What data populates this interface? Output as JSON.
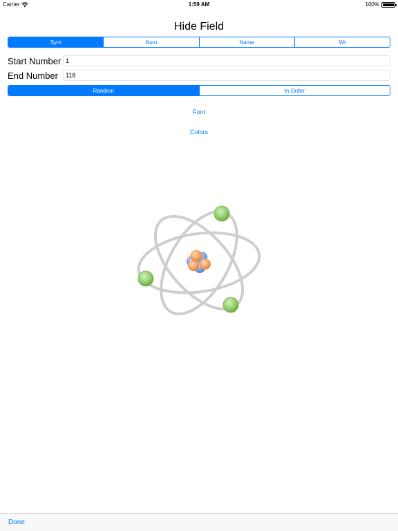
{
  "status_bar": {
    "carrier": "Carrier",
    "time": "1:59 AM",
    "battery": "100%"
  },
  "title": "Hide Field",
  "field_segments": [
    {
      "label": "Sym",
      "selected": true
    },
    {
      "label": "Num",
      "selected": false
    },
    {
      "label": "Name",
      "selected": false
    },
    {
      "label": "Wt",
      "selected": false
    }
  ],
  "start_number": {
    "label": "Start Number",
    "value": "1"
  },
  "end_number": {
    "label": "End Number",
    "value": "118"
  },
  "order_segments": [
    {
      "label": "Random",
      "selected": true
    },
    {
      "label": "In Order",
      "selected": false
    }
  ],
  "buttons": {
    "font": "Font",
    "colors": "Colors"
  },
  "toolbar": {
    "done": "Done"
  },
  "colors": {
    "accent": "#007aff",
    "electron": "#8fcf6a",
    "proton": "#f5a46a",
    "neutron": "#7f9fe0"
  }
}
